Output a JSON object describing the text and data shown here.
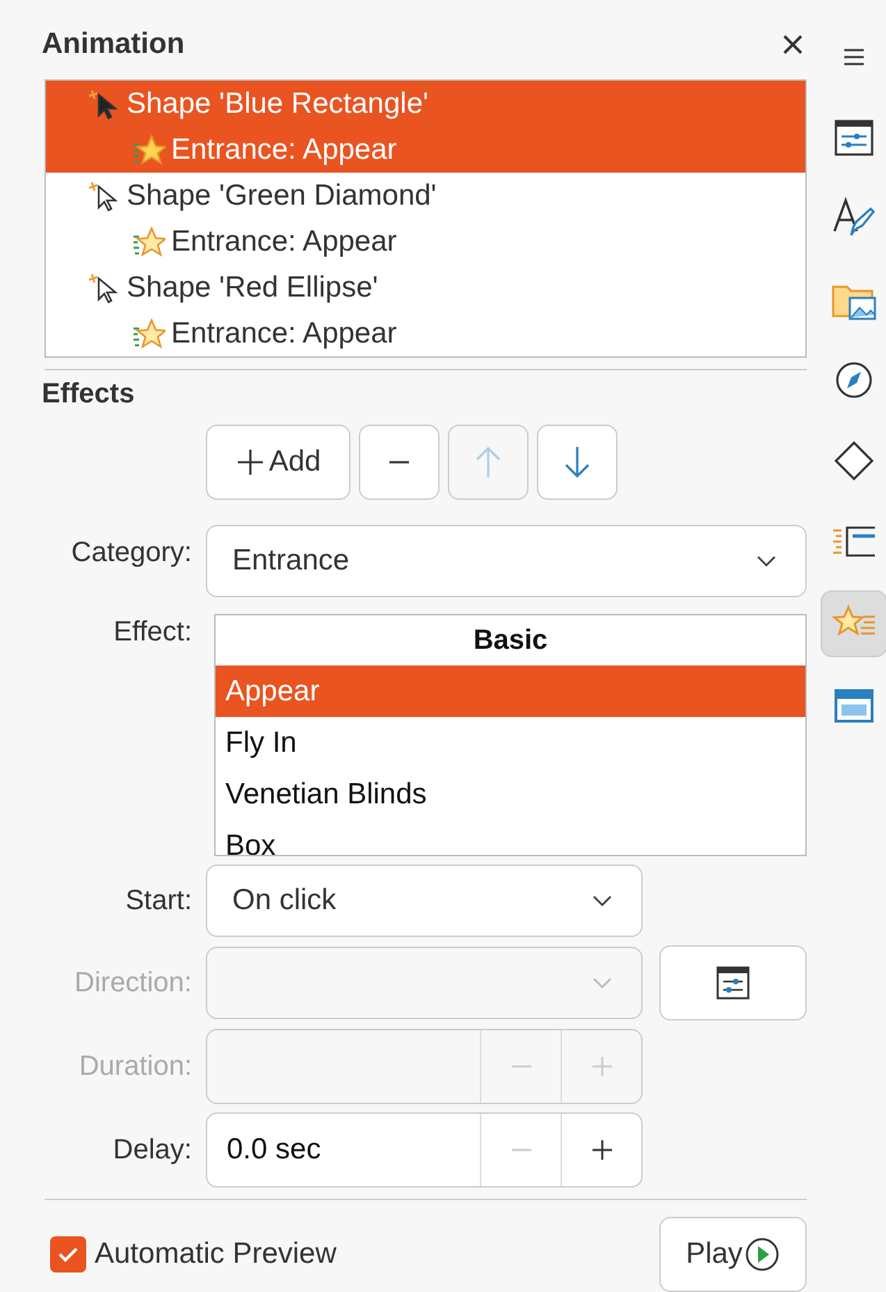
{
  "panel": {
    "title": "Animation"
  },
  "animation_list": [
    {
      "label": "Shape 'Blue Rectangle'",
      "selected": true,
      "children": [
        {
          "label": "Entrance: Appear",
          "selected": true
        }
      ]
    },
    {
      "label": "Shape 'Green Diamond'",
      "selected": false,
      "children": [
        {
          "label": "Entrance: Appear",
          "selected": false
        }
      ]
    },
    {
      "label": "Shape 'Red Ellipse'",
      "selected": false,
      "children": [
        {
          "label": "Entrance: Appear",
          "selected": false
        }
      ]
    }
  ],
  "effects": {
    "heading": "Effects",
    "buttons": [
      {
        "kind": "add",
        "label": "Add",
        "disabled": false
      },
      {
        "kind": "remove",
        "disabled": false
      },
      {
        "kind": "up",
        "disabled": true
      },
      {
        "kind": "down",
        "disabled": false
      }
    ],
    "category": {
      "label": "Category:",
      "value": "Entrance"
    },
    "effect": {
      "label": "Effect:",
      "group": "Basic",
      "items": [
        {
          "label": "Appear",
          "selected": true
        },
        {
          "label": "Fly In",
          "selected": false
        },
        {
          "label": "Venetian Blinds",
          "selected": false
        },
        {
          "label": "Box",
          "selected": false
        }
      ]
    },
    "start": {
      "label": "Start:",
      "value": "On click",
      "disabled": false
    },
    "direction": {
      "label": "Direction:",
      "disabled": true
    },
    "duration": {
      "label": "Duration:",
      "disabled": true
    },
    "delay": {
      "label": "Delay:",
      "value": "0.0 sec",
      "disabled": false
    }
  },
  "automatic_preview": {
    "label": "Automatic Preview",
    "checked": true
  },
  "play_button": {
    "label": "Play"
  },
  "sidebar": [
    {
      "kind": "menu",
      "selected": false
    },
    {
      "kind": "properties",
      "selected": false
    },
    {
      "kind": "styles",
      "selected": false
    },
    {
      "kind": "gallery",
      "selected": false
    },
    {
      "kind": "navigator",
      "selected": false
    },
    {
      "kind": "shapes",
      "selected": false
    },
    {
      "kind": "transition",
      "selected": false
    },
    {
      "kind": "animation",
      "selected": true
    },
    {
      "kind": "master",
      "selected": false
    }
  ]
}
